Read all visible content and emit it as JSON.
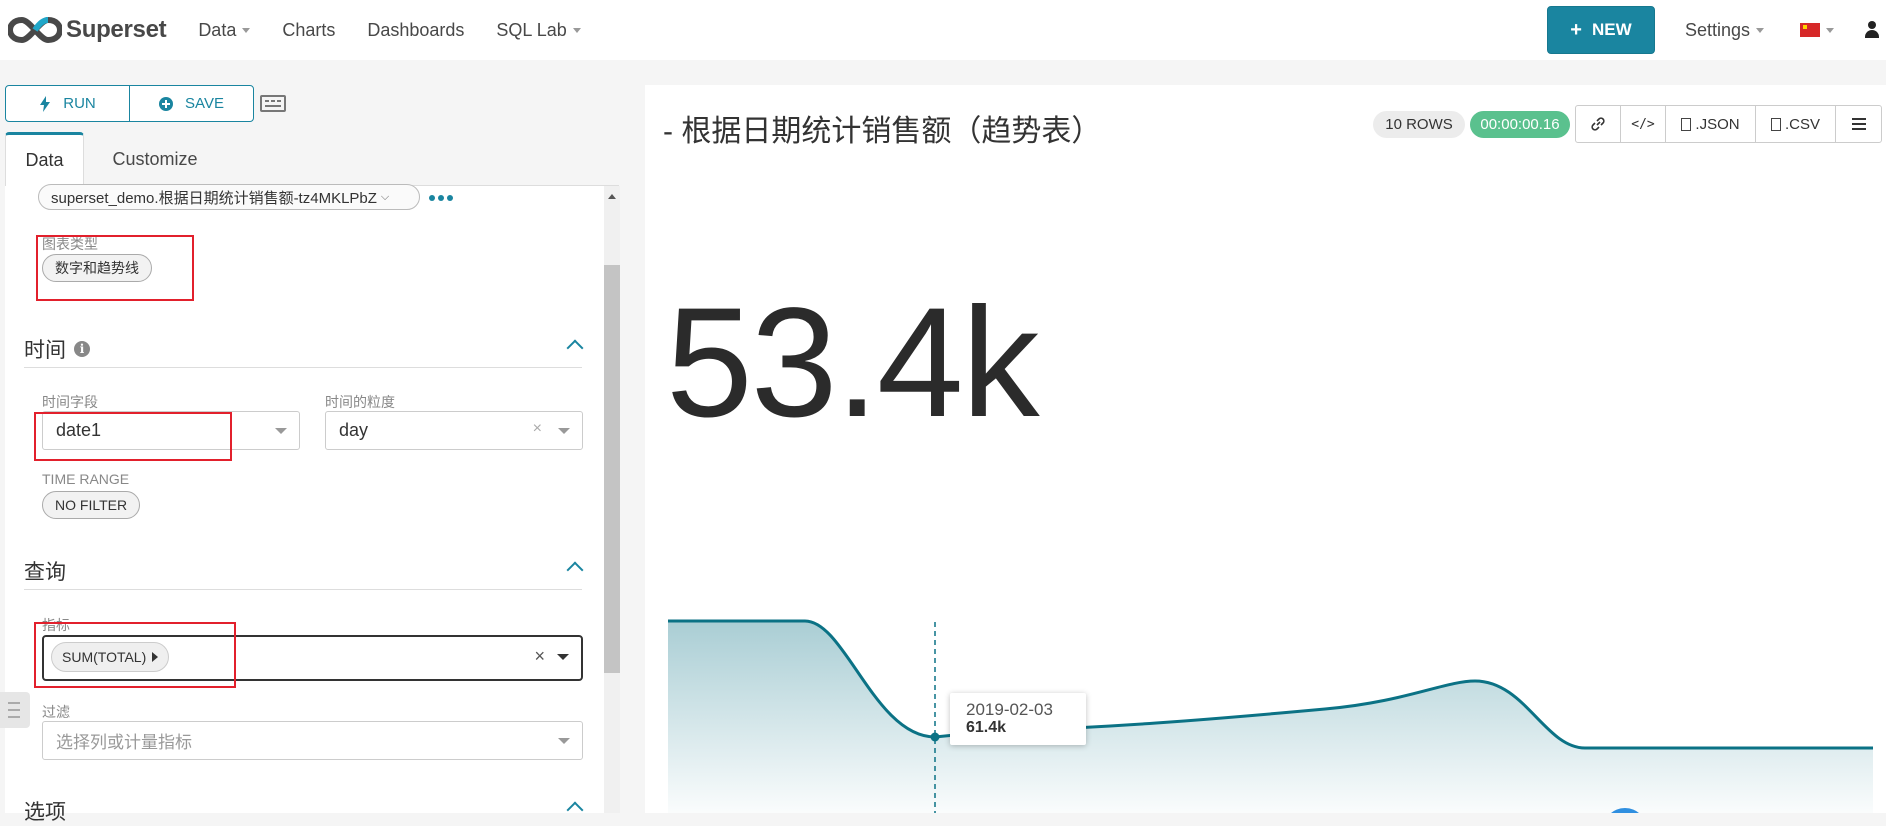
{
  "navbar": {
    "brand": "Superset",
    "menu": [
      "Data",
      "Charts",
      "Dashboards",
      "SQL Lab"
    ],
    "new_label": "NEW",
    "settings_label": "Settings"
  },
  "toolbar": {
    "run_label": "RUN",
    "save_label": "SAVE"
  },
  "tabs": [
    "Data",
    "Customize"
  ],
  "datasource": {
    "name": "superset_demo.根据日期统计销售额-tz4MKLPbZ"
  },
  "viz": {
    "label": "图表类型",
    "value": "数字和趋势线"
  },
  "time_section": {
    "title": "时间",
    "column_label": "时间字段",
    "column_value": "date1",
    "grain_label": "时间的粒度",
    "grain_value": "day",
    "range_label": "TIME RANGE",
    "range_value": "NO FILTER"
  },
  "query_section": {
    "title": "查询",
    "metric_label": "指标",
    "metric_value": "SUM(TOTAL)",
    "filter_label": "过滤",
    "filter_placeholder": "选择列或计量指标"
  },
  "options_section": {
    "title": "选项"
  },
  "chart_header": {
    "title": "- 根据日期统计销售额（趋势表）",
    "rows": "10 ROWS",
    "time": "00:00:00.16",
    "json_label": ".JSON",
    "csv_label": ".CSV"
  },
  "big_number": "53.4k",
  "tooltip": {
    "date": "2019-02-03",
    "value": "61.4k"
  },
  "colors": {
    "accent": "#1a85a0",
    "success": "#5ac18e",
    "trend_line": "#0b7285",
    "highlight_box": "#e2202c"
  }
}
